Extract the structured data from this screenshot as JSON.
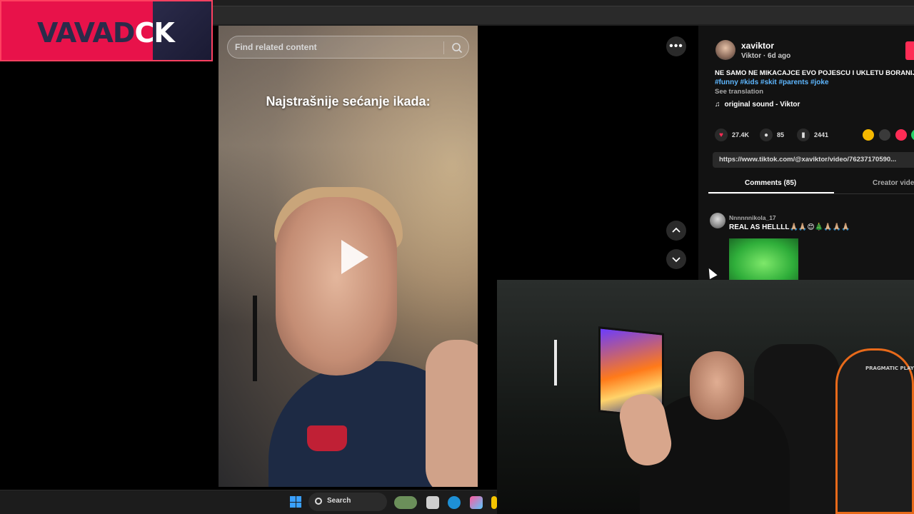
{
  "overlay": {
    "logo_text_dark": "VAVAD",
    "logo_text_light": "CK"
  },
  "video": {
    "search_placeholder": "Find related content",
    "caption": "Najstrašnije sećanje ikada:"
  },
  "controls": {
    "more_label": "•••"
  },
  "post": {
    "username": "xaviktor",
    "subline": "Viktor · 6d ago",
    "description": "NE SAMO NE MIKACAJCE EVO POJESCU I UKLETU BORANIJU",
    "hashtags": "#funny #kids #skit #parents #joke",
    "see_translation": "See translation",
    "sound": "original sound - Viktor",
    "likes": "27.4K",
    "comments": "85",
    "saves": "2441",
    "link": "https://www.tiktok.com/@xaviktor/video/76237170590..."
  },
  "tabs": {
    "comments": "Comments (85)",
    "creator": "Creator vide"
  },
  "comment": {
    "user": "Nnnnnnikola_17",
    "text": "REAL AS HELLLL🙏🏼🙏🏼😊🎄🙏🏼🙏🏼🙏🏼"
  },
  "webcam": {
    "chair_brand": "PRAGMATIC PLAY"
  },
  "taskbar": {
    "search_label": "Search"
  },
  "colors": {
    "accent": "#fe2c55",
    "link": "#5eb7ff",
    "logo_bg": "#e8124a"
  }
}
